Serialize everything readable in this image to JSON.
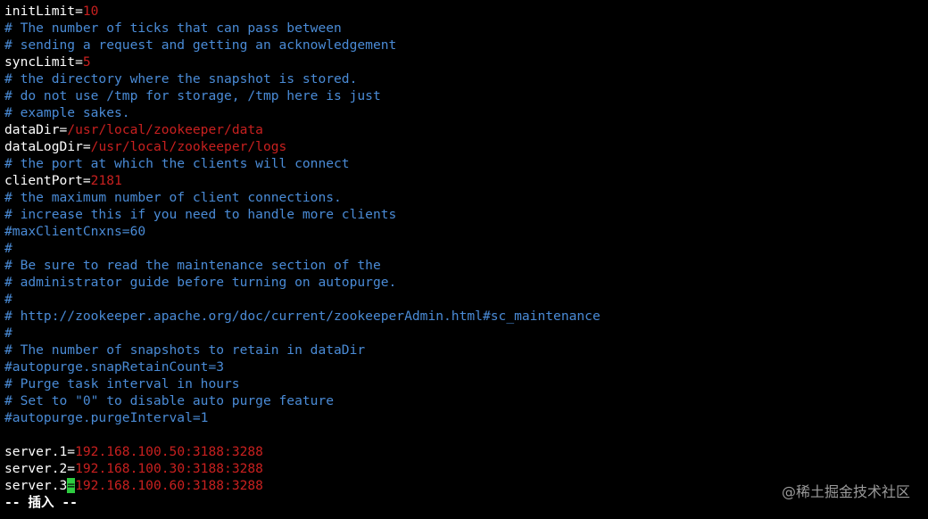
{
  "editor": {
    "lines": [
      {
        "type": "setting",
        "key": "initLimit",
        "value": "10"
      },
      {
        "type": "comment",
        "text": "# The number of ticks that can pass between"
      },
      {
        "type": "comment",
        "text": "# sending a request and getting an acknowledgement"
      },
      {
        "type": "setting",
        "key": "syncLimit",
        "value": "5"
      },
      {
        "type": "comment",
        "text": "# the directory where the snapshot is stored."
      },
      {
        "type": "comment",
        "text": "# do not use /tmp for storage, /tmp here is just"
      },
      {
        "type": "comment",
        "text": "# example sakes."
      },
      {
        "type": "setting",
        "key": "dataDir",
        "value": "/usr/local/zookeeper/data"
      },
      {
        "type": "setting",
        "key": "dataLogDir",
        "value": "/usr/local/zookeeper/logs"
      },
      {
        "type": "comment",
        "text": "# the port at which the clients will connect"
      },
      {
        "type": "setting",
        "key": "clientPort",
        "value": "2181"
      },
      {
        "type": "comment",
        "text": "# the maximum number of client connections."
      },
      {
        "type": "comment",
        "text": "# increase this if you need to handle more clients"
      },
      {
        "type": "comment",
        "text": "#maxClientCnxns=60"
      },
      {
        "type": "comment",
        "text": "#"
      },
      {
        "type": "comment",
        "text": "# Be sure to read the maintenance section of the"
      },
      {
        "type": "comment",
        "text": "# administrator guide before turning on autopurge."
      },
      {
        "type": "comment",
        "text": "#"
      },
      {
        "type": "comment",
        "text": "# http://zookeeper.apache.org/doc/current/zookeeperAdmin.html#sc_maintenance"
      },
      {
        "type": "comment",
        "text": "#"
      },
      {
        "type": "comment",
        "text": "# The number of snapshots to retain in dataDir"
      },
      {
        "type": "comment",
        "text": "#autopurge.snapRetainCount=3"
      },
      {
        "type": "comment",
        "text": "# Purge task interval in hours"
      },
      {
        "type": "comment",
        "text": "# Set to \"0\" to disable auto purge feature"
      },
      {
        "type": "comment",
        "text": "#autopurge.purgeInterval=1"
      },
      {
        "type": "blank"
      },
      {
        "type": "setting",
        "key": "server.1",
        "value": "192.168.100.50:3188:3288"
      },
      {
        "type": "setting",
        "key": "server.2",
        "value": "192.168.100.30:3188:3288"
      },
      {
        "type": "setting",
        "key": "server.3",
        "value": "192.168.100.60:3188:3288",
        "cursor": true
      }
    ],
    "status_line": "-- 插入 --"
  },
  "watermark": "@稀土掘金技术社区",
  "colors": {
    "background": "#000000",
    "key": "#ffffff",
    "value": "#c8201f",
    "comment": "#4a8bd6",
    "cursor": "#2ecc40"
  }
}
